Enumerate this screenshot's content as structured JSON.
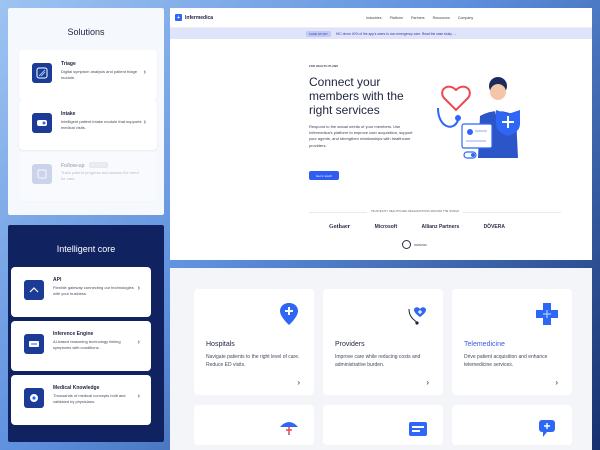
{
  "solutions": {
    "title": "Solutions",
    "cards": [
      {
        "title": "Triage",
        "desc": "Digital symptom analysis and patient triage module."
      },
      {
        "title": "Intake",
        "desc": "Intelligent patient intake module that supports medical visits."
      },
      {
        "title": "Follow-up",
        "tag": "IN PILOT",
        "desc": "Track patient progress and assess the need for care."
      }
    ]
  },
  "core": {
    "title": "Intelligent core",
    "cards": [
      {
        "title": "API",
        "desc": "Flexible gateway connecting our technologies with your business."
      },
      {
        "title": "Inference Engine",
        "desc": "AI-based reasoning technology linking symptoms with conditions."
      },
      {
        "title": "Medical Knowledge",
        "desc": "Thousands of medical concepts built and validated by physicians."
      }
    ]
  },
  "site": {
    "brand": "Infermedica",
    "nav": [
      "Industries",
      "Platform",
      "Partners",
      "Resources",
      "Company"
    ],
    "banner_pill": "CASE STUDY",
    "banner_text": "HIC drove 40% of the app's users to non-emergency care. Read the case study →",
    "eyebrow": "FOR HEALTH PLANS",
    "headline": "Connect your members with the right services",
    "lead": "Respond to the actual needs of your members. Use Infermedica's platform to improve user acquisition, support your agents, and strengthen relationships with healthcare providers.",
    "cta": "Get in touch",
    "trusted": "TRUSTED BY HEALTHCARE ORGANIZATIONS AROUND THE WORLD",
    "logos": [
      "Gothaer",
      "Microsoft",
      "Allianz Partners",
      "DÖVERA"
    ],
    "logo6": "OMNIUM"
  },
  "services": [
    {
      "title": "Hospitals",
      "desc": "Navigate patients to the right level of care. Reduce ED visits.",
      "color": "#1d2340"
    },
    {
      "title": "Providers",
      "desc": "Improve care while reducing costs and administrative burden.",
      "color": "#1d2340"
    },
    {
      "title": "Telemedicine",
      "desc": "Drive patient acquisition and enhance telemedicine services.",
      "color": "#3a5be0"
    }
  ],
  "colors": {
    "accent": "#2f5cf2",
    "navy": "#102360",
    "icon_blue": "#1c3b97"
  }
}
